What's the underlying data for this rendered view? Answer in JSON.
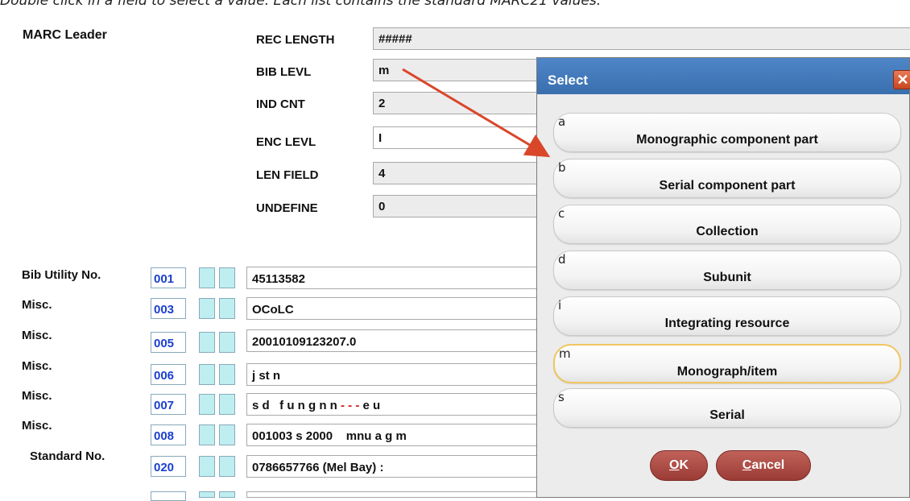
{
  "caption": "Double click in a field to select a value. Each list contains the standard MARC21 values.",
  "leader": {
    "title": "MARC Leader",
    "fields": [
      {
        "label": "REC LENGTH",
        "value": "#####"
      },
      {
        "label": "BIB LEVL",
        "value": "m"
      },
      {
        "label": "IND CNT",
        "value": "2"
      },
      {
        "label": "ENC LEVL",
        "value": "I"
      },
      {
        "label": "LEN FIELD",
        "value": "4"
      },
      {
        "label": "UNDEFINE",
        "value": "0"
      }
    ]
  },
  "records": [
    {
      "label": "Bib Utility No.",
      "tag": "001",
      "value": "45113582"
    },
    {
      "label": "Misc.",
      "tag": "003",
      "value": "OCoLC"
    },
    {
      "label": "Misc.",
      "tag": "005",
      "value": "20010109123207.0"
    },
    {
      "label": "Misc.",
      "tag": "006",
      "value": "j st n"
    },
    {
      "label": "Misc.",
      "tag": "007",
      "value_parts": [
        "s d   f u n g n n ",
        "- - - ",
        "e u"
      ]
    },
    {
      "label": "Misc.",
      "tag": "008",
      "value": "001003 s 2000    mnu a g m"
    },
    {
      "label": "Standard No.",
      "tag": "020",
      "value": "0786657766 (Mel Bay) :"
    }
  ],
  "dialog": {
    "title": "Select",
    "close_glyph": "✕",
    "options": [
      {
        "code": "a",
        "label": "Monographic component part"
      },
      {
        "code": "b",
        "label": "Serial component part"
      },
      {
        "code": "c",
        "label": "Collection"
      },
      {
        "code": "d",
        "label": "Subunit"
      },
      {
        "code": "i",
        "label": "Integrating resource"
      },
      {
        "code": "m",
        "label": "Monograph/item",
        "selected": true
      },
      {
        "code": "s",
        "label": "Serial"
      }
    ],
    "ok_underline": "O",
    "ok_rest": "K",
    "cancel_underline": "C",
    "cancel_rest": "ancel"
  },
  "colors": {
    "tag_text": "#1a3fd0",
    "indicator_fill": "#bfeef0",
    "arrow": "#d9472b",
    "titlebar": "#4478bb",
    "button": "#a9463f",
    "selected_border": "#f1c560"
  }
}
